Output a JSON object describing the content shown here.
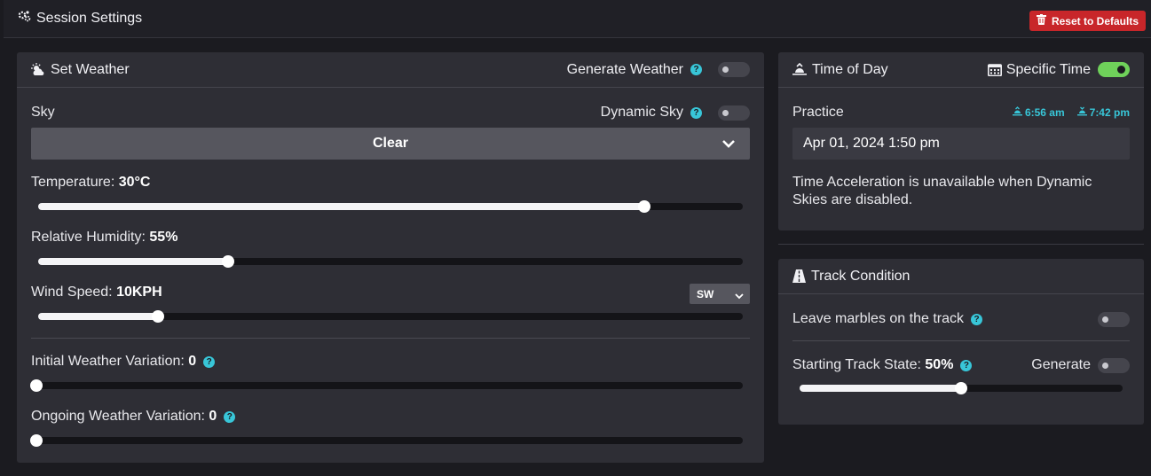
{
  "header": {
    "title": "Session Settings",
    "reset_label": "Reset to Defaults"
  },
  "weather": {
    "title": "Set Weather",
    "generate_label": "Generate Weather",
    "generate_on": false,
    "sky_label": "Sky",
    "dynamic_sky_label": "Dynamic Sky",
    "dynamic_sky_on": false,
    "sky_value": "Clear",
    "temperature_label": "Temperature:",
    "temperature_value": "30°C",
    "temperature_fraction": 0.86,
    "humidity_label": "Relative Humidity:",
    "humidity_value": "55%",
    "humidity_fraction": 0.27,
    "wind_label": "Wind Speed:",
    "wind_value": "10KPH",
    "wind_fraction": 0.17,
    "wind_direction": "SW",
    "initial_variation_label": "Initial Weather Variation:",
    "initial_variation_value": "0",
    "initial_variation_fraction": 0,
    "ongoing_variation_label": "Ongoing Weather Variation:",
    "ongoing_variation_value": "0",
    "ongoing_variation_fraction": 0
  },
  "time": {
    "title": "Time of Day",
    "specific_label": "Specific Time",
    "specific_on": true,
    "session_label": "Practice",
    "sunrise": "6:56 am",
    "sunset": "7:42 pm",
    "datetime_value": "Apr 01, 2024 1:50 pm",
    "note": "Time Acceleration is unavailable when Dynamic Skies are disabled."
  },
  "track": {
    "title": "Track Condition",
    "marbles_label": "Leave marbles on the track",
    "marbles_on": false,
    "state_label": "Starting Track State:",
    "state_value": "50%",
    "state_fraction": 0.5,
    "generate_label": "Generate",
    "generate_on": false
  },
  "colors": {
    "accent": "#38c6d8",
    "danger": "#c8262a",
    "toggle_on": "#6fd15a",
    "panel": "#2e2e35",
    "background": "#1b1b20"
  }
}
